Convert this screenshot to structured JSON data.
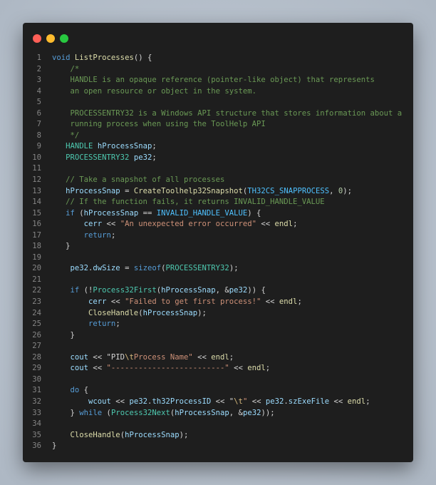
{
  "window": {
    "buttons": {
      "close_color": "#ff5f57",
      "minimize_color": "#febc2e",
      "maximize_color": "#28c840"
    }
  },
  "theme": {
    "background": "#1e1e1e",
    "keyword": "#569cd6",
    "function": "#dcdcaa",
    "type": "#4ec9b0",
    "comment": "#6a9955",
    "string": "#ce9178",
    "constant": "#4fc1ff",
    "variable": "#9cdcfe",
    "number": "#b5cea8"
  },
  "code": {
    "lines": [
      {
        "num": "1",
        "tokens": [
          {
            "t": "void",
            "c": "kw"
          },
          {
            "t": " "
          },
          {
            "t": "ListProcesses",
            "c": "fn"
          },
          {
            "t": "() {"
          }
        ]
      },
      {
        "num": "2",
        "tokens": [
          {
            "t": "    /*",
            "c": "cm"
          }
        ]
      },
      {
        "num": "3",
        "tokens": [
          {
            "t": "    HANDLE is an opaque reference (pointer-like object) that represents",
            "c": "cm"
          }
        ]
      },
      {
        "num": "4",
        "tokens": [
          {
            "t": "    an open resource or object in the system.",
            "c": "cm"
          }
        ]
      },
      {
        "num": "5",
        "tokens": []
      },
      {
        "num": "6",
        "tokens": [
          {
            "t": "    PROCESSENTRY32 is a Windows API structure that stores information about a",
            "c": "cm"
          }
        ]
      },
      {
        "num": "7",
        "tokens": [
          {
            "t": "    running process when using the ToolHelp API",
            "c": "cm"
          }
        ]
      },
      {
        "num": "8",
        "tokens": [
          {
            "t": "    */",
            "c": "cm"
          }
        ]
      },
      {
        "num": "9",
        "tokens": [
          {
            "t": "   "
          },
          {
            "t": "HANDLE",
            "c": "ty"
          },
          {
            "t": " "
          },
          {
            "t": "hProcessSnap",
            "c": "var"
          },
          {
            "t": ";"
          }
        ]
      },
      {
        "num": "10",
        "tokens": [
          {
            "t": "   "
          },
          {
            "t": "PROCESSENTRY32",
            "c": "ty"
          },
          {
            "t": " "
          },
          {
            "t": "pe32",
            "c": "var"
          },
          {
            "t": ";"
          }
        ]
      },
      {
        "num": "11",
        "tokens": []
      },
      {
        "num": "12",
        "tokens": [
          {
            "t": "   // Take a snapshot of all processes",
            "c": "cm"
          }
        ]
      },
      {
        "num": "13",
        "tokens": [
          {
            "t": "   "
          },
          {
            "t": "hProcessSnap",
            "c": "var"
          },
          {
            "t": " = "
          },
          {
            "t": "CreateToolhelp32Snapshot",
            "c": "fn"
          },
          {
            "t": "("
          },
          {
            "t": "TH32CS_SNAPPROCESS",
            "c": "cst"
          },
          {
            "t": ", "
          },
          {
            "t": "0",
            "c": "num"
          },
          {
            "t": ");"
          }
        ]
      },
      {
        "num": "14",
        "tokens": [
          {
            "t": "   // If the function fails, it returns INVALID_HANDLE_VALUE",
            "c": "cm"
          }
        ]
      },
      {
        "num": "15",
        "tokens": [
          {
            "t": "   "
          },
          {
            "t": "if",
            "c": "kw"
          },
          {
            "t": " ("
          },
          {
            "t": "hProcessSnap",
            "c": "var"
          },
          {
            "t": " == "
          },
          {
            "t": "INVALID_HANDLE_VALUE",
            "c": "cst"
          },
          {
            "t": ") {"
          }
        ]
      },
      {
        "num": "16",
        "tokens": [
          {
            "t": "       "
          },
          {
            "t": "cerr",
            "c": "var"
          },
          {
            "t": " << "
          },
          {
            "t": "\"An unexpected error occurred\"",
            "c": "str"
          },
          {
            "t": " << "
          },
          {
            "t": "endl",
            "c": "fn"
          },
          {
            "t": ";"
          }
        ]
      },
      {
        "num": "17",
        "tokens": [
          {
            "t": "       "
          },
          {
            "t": "return",
            "c": "kw"
          },
          {
            "t": ";"
          }
        ]
      },
      {
        "num": "18",
        "tokens": [
          {
            "t": "   }"
          }
        ]
      },
      {
        "num": "19",
        "tokens": []
      },
      {
        "num": "20",
        "tokens": [
          {
            "t": "    "
          },
          {
            "t": "pe32",
            "c": "var"
          },
          {
            "t": "."
          },
          {
            "t": "dwSize",
            "c": "var"
          },
          {
            "t": " = "
          },
          {
            "t": "sizeof",
            "c": "kw"
          },
          {
            "t": "("
          },
          {
            "t": "PROCESSENTRY32",
            "c": "ty"
          },
          {
            "t": ");"
          }
        ]
      },
      {
        "num": "21",
        "tokens": []
      },
      {
        "num": "22",
        "tokens": [
          {
            "t": "    "
          },
          {
            "t": "if",
            "c": "kw"
          },
          {
            "t": " (!"
          },
          {
            "t": "Process32First",
            "c": "ty"
          },
          {
            "t": "("
          },
          {
            "t": "hProcessSnap",
            "c": "var"
          },
          {
            "t": ", &"
          },
          {
            "t": "pe32",
            "c": "var"
          },
          {
            "t": ")) {"
          }
        ]
      },
      {
        "num": "23",
        "tokens": [
          {
            "t": "        "
          },
          {
            "t": "cerr",
            "c": "var"
          },
          {
            "t": " << "
          },
          {
            "t": "\"Failed to get first process!\"",
            "c": "str"
          },
          {
            "t": " << "
          },
          {
            "t": "endl",
            "c": "fn"
          },
          {
            "t": ";"
          }
        ]
      },
      {
        "num": "24",
        "tokens": [
          {
            "t": "        "
          },
          {
            "t": "CloseHandle",
            "c": "fn"
          },
          {
            "t": "("
          },
          {
            "t": "hProcessSnap",
            "c": "var"
          },
          {
            "t": ");"
          }
        ]
      },
      {
        "num": "25",
        "tokens": [
          {
            "t": "        "
          },
          {
            "t": "return",
            "c": "kw"
          },
          {
            "t": ";"
          }
        ]
      },
      {
        "num": "26",
        "tokens": [
          {
            "t": "    }"
          }
        ]
      },
      {
        "num": "27",
        "tokens": []
      },
      {
        "num": "28",
        "tokens": [
          {
            "t": "    "
          },
          {
            "t": "cout",
            "c": "var"
          },
          {
            "t": " << "
          },
          {
            "t": "\"PID"
          },
          {
            "t": "\\t",
            "c": "esc"
          },
          {
            "t": "Process Name\"",
            "c": "str"
          },
          {
            "t": " << "
          },
          {
            "t": "endl",
            "c": "fn"
          },
          {
            "t": ";"
          }
        ]
      },
      {
        "num": "29",
        "tokens": [
          {
            "t": "    "
          },
          {
            "t": "cout",
            "c": "var"
          },
          {
            "t": " << "
          },
          {
            "t": "\"-------------------------\"",
            "c": "str"
          },
          {
            "t": " << "
          },
          {
            "t": "endl",
            "c": "fn"
          },
          {
            "t": ";"
          }
        ]
      },
      {
        "num": "30",
        "tokens": []
      },
      {
        "num": "31",
        "tokens": [
          {
            "t": "    "
          },
          {
            "t": "do",
            "c": "kw"
          },
          {
            "t": " {"
          }
        ]
      },
      {
        "num": "32",
        "tokens": [
          {
            "t": "        "
          },
          {
            "t": "wcout",
            "c": "var"
          },
          {
            "t": " << "
          },
          {
            "t": "pe32",
            "c": "var"
          },
          {
            "t": "."
          },
          {
            "t": "th32ProcessID",
            "c": "var"
          },
          {
            "t": " << "
          },
          {
            "t": "\""
          },
          {
            "t": "\\t",
            "c": "esc"
          },
          {
            "t": "\"",
            "c": "str"
          },
          {
            "t": " << "
          },
          {
            "t": "pe32",
            "c": "var"
          },
          {
            "t": "."
          },
          {
            "t": "szExeFile",
            "c": "var"
          },
          {
            "t": " << "
          },
          {
            "t": "endl",
            "c": "fn"
          },
          {
            "t": ";"
          }
        ]
      },
      {
        "num": "33",
        "tokens": [
          {
            "t": "    } "
          },
          {
            "t": "while",
            "c": "kw"
          },
          {
            "t": " ("
          },
          {
            "t": "Process32Next",
            "c": "ty"
          },
          {
            "t": "("
          },
          {
            "t": "hProcessSnap",
            "c": "var"
          },
          {
            "t": ", &"
          },
          {
            "t": "pe32",
            "c": "var"
          },
          {
            "t": "));"
          }
        ]
      },
      {
        "num": "34",
        "tokens": []
      },
      {
        "num": "35",
        "tokens": [
          {
            "t": "    "
          },
          {
            "t": "CloseHandle",
            "c": "fn"
          },
          {
            "t": "("
          },
          {
            "t": "hProcessSnap",
            "c": "var"
          },
          {
            "t": ");"
          }
        ]
      },
      {
        "num": "36",
        "tokens": [
          {
            "t": "}"
          }
        ]
      }
    ]
  }
}
